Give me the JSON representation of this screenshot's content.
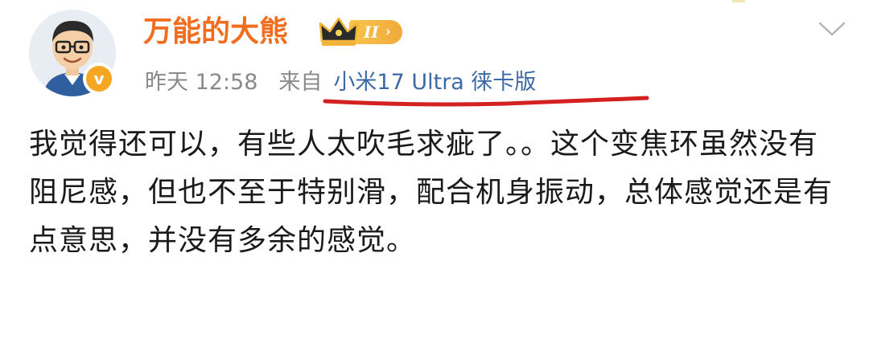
{
  "user": {
    "name": "万能的大熊",
    "level": "II",
    "verified_mark": "v",
    "avatar_icon": "cartoon-avatar",
    "crown_icon": "crown-icon"
  },
  "meta": {
    "time": "昨天 12:58",
    "from_label": "来自",
    "device": "小米17 Ultra 徕卡版"
  },
  "post": {
    "text": "我觉得还可以，有些人太吹毛求疵了。。这个变焦环虽然没有阻尼感，但也不至于特别滑，配合机身振动，总体感觉还是有点意思，并没有多余的感觉。"
  },
  "colors": {
    "username": "#f26d1e",
    "device_link": "#3d6aa5",
    "meta_text": "#8a8a8a",
    "annotation": "#d42020",
    "badge": "#f5a623"
  }
}
